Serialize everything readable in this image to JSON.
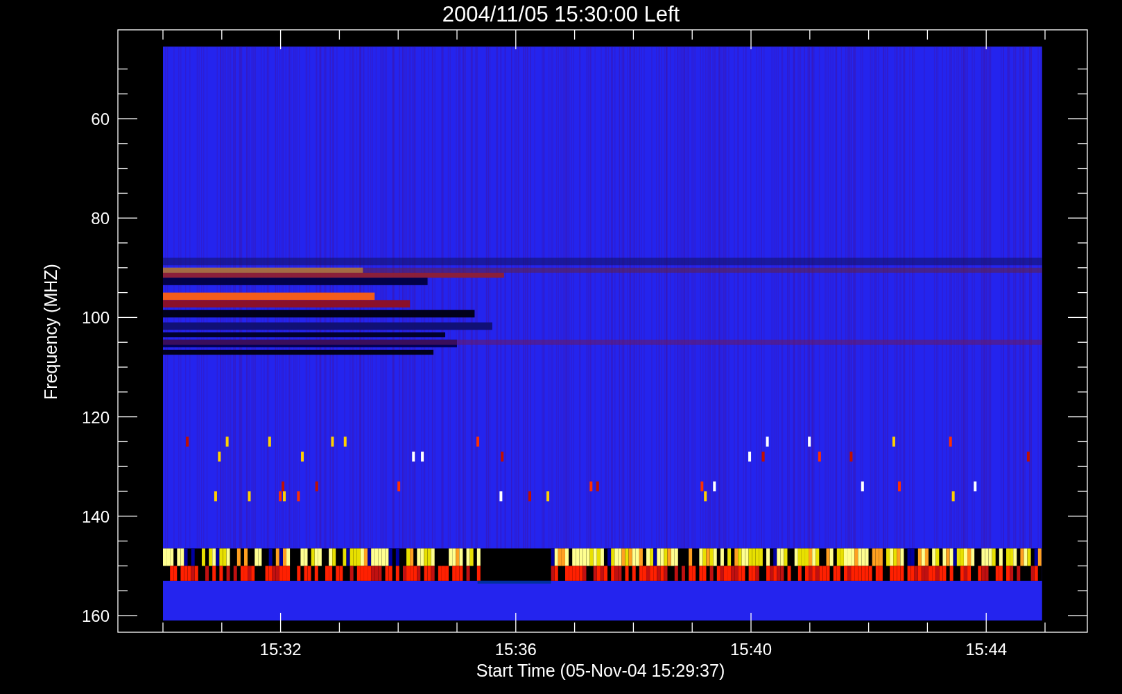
{
  "title": "2004/11/05 15:30:00 Left",
  "y_axis": {
    "label": "Frequency (MHZ)",
    "ticks": [
      "60",
      "80",
      "100",
      "120",
      "140",
      "160"
    ]
  },
  "x_axis": {
    "label": "Start Time (05-Nov-04 15:29:37)",
    "ticks": [
      "15:32",
      "15:36",
      "15:40",
      "15:44"
    ]
  }
}
